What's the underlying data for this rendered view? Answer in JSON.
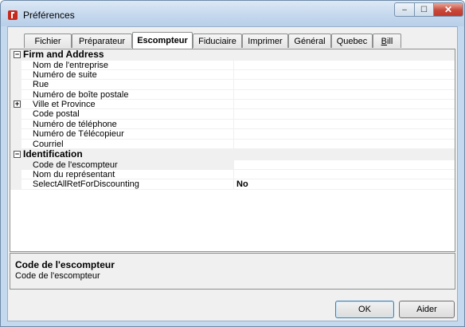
{
  "window": {
    "title": "Préférences",
    "controls": {
      "minimize": "–",
      "maximize": "☐",
      "close": "✕"
    }
  },
  "tabs": [
    {
      "label": "Fichier"
    },
    {
      "label": "Préparateur"
    },
    {
      "label": "Escompteur",
      "active": true
    },
    {
      "label": "Fiduciaire"
    },
    {
      "label": "Imprimer"
    },
    {
      "label": "Général"
    },
    {
      "label": "Quebec"
    },
    {
      "label_first": "B",
      "label_rest": "ill"
    }
  ],
  "grid": {
    "cat1": {
      "label": "Firm and Address",
      "expander": "−"
    },
    "rows1": [
      {
        "label": "Nom de l'entreprise",
        "value": ""
      },
      {
        "label": "Numéro de suite",
        "value": ""
      },
      {
        "label": "Rue",
        "value": ""
      },
      {
        "label": "Numéro de boîte postale",
        "value": ""
      },
      {
        "label": "Ville et Province",
        "value": "",
        "expander": "+"
      },
      {
        "label": "Code postal",
        "value": ""
      },
      {
        "label": "Numéro de téléphone",
        "value": ""
      },
      {
        "label": "Numéro de Télécopieur",
        "value": ""
      },
      {
        "label": "Courriel",
        "value": ""
      }
    ],
    "cat2": {
      "label": "Identification",
      "expander": "−"
    },
    "rows2": [
      {
        "label": "Code de l'escompteur",
        "value": ""
      },
      {
        "label": "Nom du représentant",
        "value": ""
      },
      {
        "label": "SelectAllRetForDiscounting",
        "value": "No"
      }
    ]
  },
  "description": {
    "title": "Code de l'escompteur",
    "text": "Code de l'escompteur"
  },
  "buttons": {
    "ok": "OK",
    "help": "Aider"
  }
}
